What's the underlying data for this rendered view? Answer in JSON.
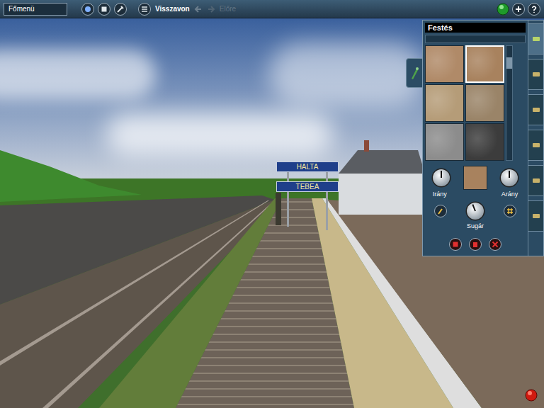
{
  "top_bar": {
    "main_menu": "Főmenü",
    "undo": {
      "label": "Visszavon",
      "disabled": false
    },
    "redo": {
      "label": "Előre",
      "disabled": true
    }
  },
  "scene": {
    "signs": [
      "HALTA",
      "TEBEA"
    ]
  },
  "paint_panel": {
    "title": "Festés",
    "textures": [
      {
        "color": "#b08a68",
        "selected": false
      },
      {
        "color": "#a8825e",
        "selected": true
      },
      {
        "color": "#b59c78",
        "selected": false
      },
      {
        "color": "#9a8468",
        "selected": false
      },
      {
        "color": "#8c8c8c",
        "selected": false
      },
      {
        "color": "#3c3c3c",
        "selected": false
      }
    ],
    "scroll_level": 0.1,
    "current_color": "#a8825e",
    "dials": [
      {
        "label": "Irány",
        "level": 0.5
      },
      {
        "label": "Arány",
        "level": 0.5
      },
      {
        "label": "Sugár",
        "level": 0.42
      }
    ]
  },
  "side_tabs": [
    {
      "selected": true
    },
    {
      "selected": false
    },
    {
      "selected": false
    },
    {
      "selected": false
    },
    {
      "selected": false
    },
    {
      "selected": false
    }
  ]
}
